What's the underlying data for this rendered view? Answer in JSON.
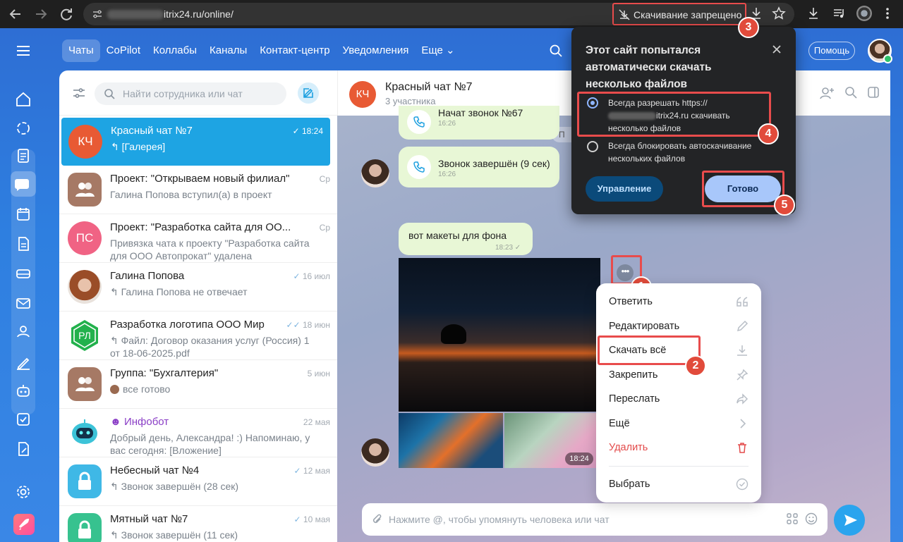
{
  "browser": {
    "url_visible": "itrix24.ru/online/",
    "download_blocked_label": "Скачивание запрещено"
  },
  "header": {
    "tabs": [
      "Чаты",
      "CoPilot",
      "Коллабы",
      "Каналы",
      "Контакт-центр",
      "Уведомления",
      "Еще ⌄"
    ],
    "help_label": "Помощь"
  },
  "chat_list": {
    "search_placeholder": "Найти сотрудника или чат",
    "items": [
      {
        "avatar_text": "КЧ",
        "name": "Красный чат №7",
        "sub": "↰ [Галерея]",
        "time": "18:24",
        "check": "✓"
      },
      {
        "avatar_text": "",
        "name": "Проект: \"Открываем новый филиал\"",
        "sub": "Галина Попова вступил(а) в проект",
        "time": "Ср",
        "check": ""
      },
      {
        "avatar_text": "ПС",
        "name": "Проект: \"Разработка сайта для ОО...",
        "sub": "Привязка чата к проекту \"Разработка сайта для ООО Автопрокат\" удалена",
        "time": "Ср",
        "check": ""
      },
      {
        "avatar_text": "",
        "name": "Галина Попова",
        "sub": "↰ Галина Попова не отвечает",
        "time": "16 июл",
        "check": "✓"
      },
      {
        "avatar_text": "РЛ",
        "name": "Разработка логотипа ООО Мир",
        "sub": "↰ Файл: Договор оказания услуг (Россия) 1 от 18-06-2025.pdf",
        "time": "18 июн",
        "check": "✓✓"
      },
      {
        "avatar_text": "",
        "name": "Группа: \"Бухгалтерия\"",
        "sub": "все готово",
        "time": "5 июн",
        "check": ""
      },
      {
        "avatar_text": "",
        "name": "Инфобот",
        "sub": "Добрый день, Александра! :) Напоминаю, у вас сегодня: [Вложение]",
        "time": "22 мая",
        "check": ""
      },
      {
        "avatar_text": "",
        "name": "Небесный чат №4",
        "sub": "↰ Звонок завершён (28 сек)",
        "time": "12 мая",
        "check": "✓"
      },
      {
        "avatar_text": "",
        "name": "Мятный чат №7",
        "sub": "↰ Звонок завершён (11 сек)",
        "time": "10 мая",
        "check": "✓"
      }
    ]
  },
  "chat": {
    "avatar_text": "КЧ",
    "title": "Красный чат №7",
    "members": "3 участника",
    "messages": [
      {
        "text": "Начат звонок №67",
        "time": "16:26"
      },
      {
        "text": "Звонок завершён (9 сек)",
        "time": "16:26"
      },
      {
        "text": "вот макеты для фона",
        "time": "18:23 ✓"
      }
    ],
    "system_pill": "П",
    "photo_time": "18:24",
    "input_placeholder": "Нажмите @, чтобы упомянуть человека или чат"
  },
  "context_menu": {
    "items": [
      "Ответить",
      "Редактировать",
      "Скачать всё",
      "Закрепить",
      "Переслать",
      "Ещё",
      "Удалить",
      "Выбрать"
    ]
  },
  "popup": {
    "title": "Этот сайт попытался автоматически скачать несколько файлов",
    "option_allow_1": "Всегда разрешать https://",
    "option_allow_2": "itrix24.ru скачивать",
    "option_allow_3": "несколько файлов",
    "option_block_1": "Всегда блокировать автоскачивание",
    "option_block_2": "нескольких файлов",
    "manage_label": "Управление",
    "done_label": "Готово"
  },
  "annotations": [
    "1",
    "2",
    "3",
    "4",
    "5"
  ],
  "colors": {
    "highlight": "#e84c4c",
    "selected_chat": "#1ea4e3",
    "brand_blue": "#2e6ed4"
  }
}
